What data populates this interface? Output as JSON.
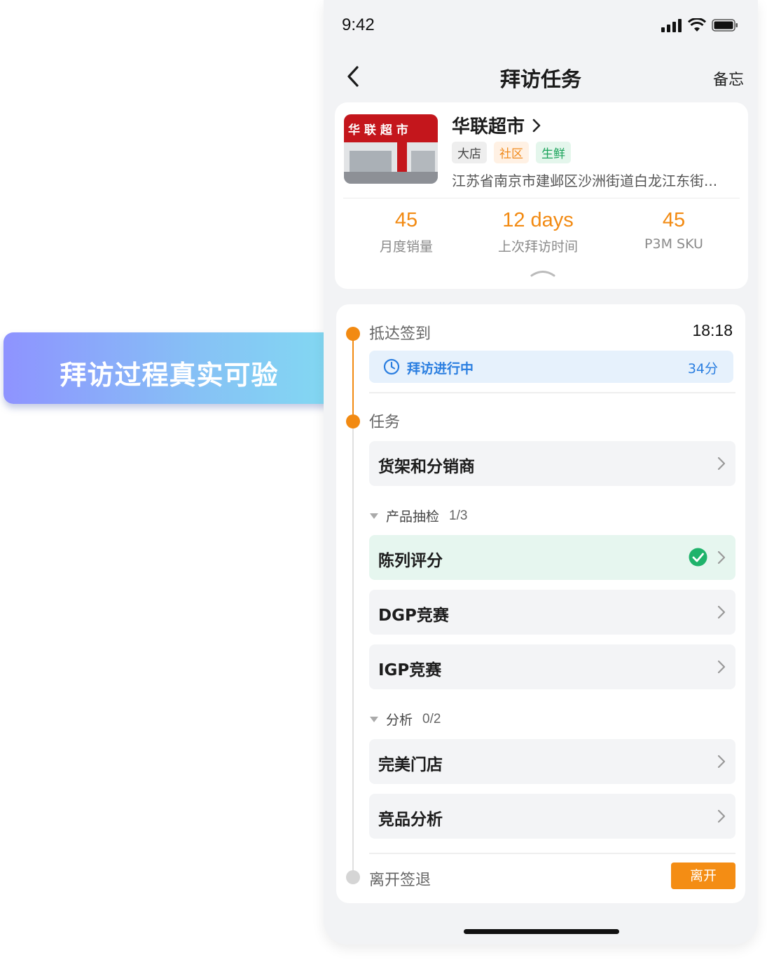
{
  "status_bar": {
    "time": "9:42"
  },
  "nav": {
    "title": "拜访任务",
    "memo": "备忘"
  },
  "store": {
    "name": "华联超市",
    "sign_text": "华 联 超 市",
    "tags": [
      "大店",
      "社区",
      "生鲜"
    ],
    "address": "江苏省南京市建邺区沙洲街道白龙江东街...",
    "stats": [
      {
        "value": "45",
        "label": "月度销量"
      },
      {
        "value": "12 days",
        "label": "上次拜访时间"
      },
      {
        "value": "45",
        "label": "P3M SKU"
      }
    ]
  },
  "checkin": {
    "label": "抵达签到",
    "time": "18:18",
    "status_text": "拜访进行中",
    "status_duration": "34分"
  },
  "tasks": {
    "label": "任务",
    "row_shelf": "货架和分销商",
    "group1": {
      "label": "产品抽检",
      "count": "1/3"
    },
    "row_display": "陈列评分",
    "row_dgp": "DGP竞赛",
    "row_igp": "IGP竞赛",
    "group2": {
      "label": "分析",
      "count": "0/2"
    },
    "row_perfect": "完美门店",
    "row_competitor": "竞品分析"
  },
  "checkout": {
    "label": "离开签退",
    "button": "离开"
  },
  "callout": {
    "text": "拜访过程真实可验"
  },
  "colors": {
    "accent": "#f28a12",
    "blue": "#2a7ee0",
    "green": "#1fb36b"
  }
}
